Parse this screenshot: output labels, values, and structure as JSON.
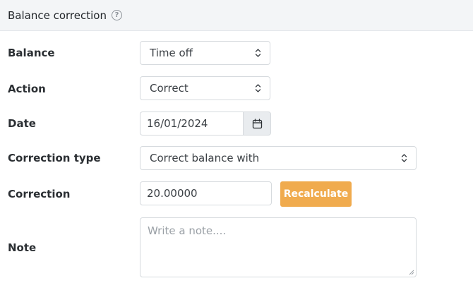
{
  "header": {
    "title": "Balance correction",
    "help_glyph": "?"
  },
  "form": {
    "balance": {
      "label": "Balance",
      "value": "Time off"
    },
    "action": {
      "label": "Action",
      "value": "Correct"
    },
    "date": {
      "label": "Date",
      "value": "16/01/2024"
    },
    "correction_type": {
      "label": "Correction type",
      "value": "Correct balance with"
    },
    "correction": {
      "label": "Correction",
      "value": "20.00000",
      "button_label": "Recalculate"
    },
    "note": {
      "label": "Note",
      "placeholder": "Write a note...."
    }
  },
  "colors": {
    "header_bg": "#f3f5f7",
    "accent": "#f0ab4e",
    "border": "#d6dade"
  },
  "icons": {
    "help": "question-circle-icon",
    "select": "chevron-up-down-icon",
    "date": "calendar-icon"
  }
}
